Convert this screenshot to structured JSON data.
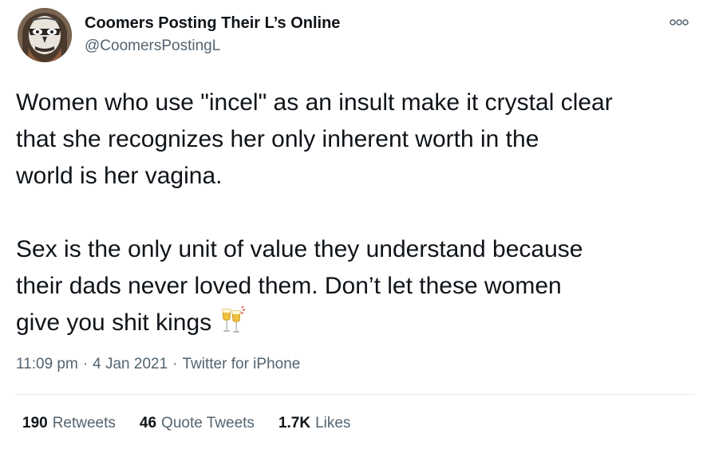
{
  "author": {
    "display_name": "Coomers Posting Their L’s Online",
    "handle": "@CoomersPostingL",
    "avatar_icon": "skull-face-avatar"
  },
  "more_icon": "more-dots-icon",
  "tweet": {
    "lines_para1": [
      "Women who use \"incel\" as an insult make it crystal clear",
      "that she recognizes her only inherent worth in the",
      "world is her vagina."
    ],
    "lines_para2": [
      "Sex is the only unit of value they understand because",
      "their dads never loved them. Don’t let these women",
      "give you shit kings"
    ],
    "emoji": "clinking-glasses-emoji"
  },
  "meta": {
    "time": "11:09 pm",
    "separator": "·",
    "date": "4 Jan 2021",
    "source": "Twitter for iPhone"
  },
  "stats": {
    "retweets_count": "190",
    "retweets_label": "Retweets",
    "quotes_count": "46",
    "quotes_label": "Quote Tweets",
    "likes_count": "1.7K",
    "likes_label": "Likes"
  },
  "colors": {
    "text": "#0f1419",
    "secondary": "#536471",
    "divider": "#e6ecf0"
  }
}
